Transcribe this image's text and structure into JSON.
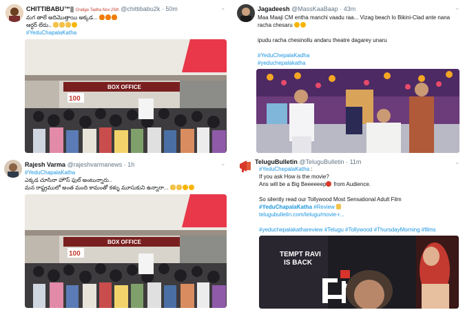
{
  "tweets": [
    {
      "name": "CHITTIBABU™||",
      "badge": "Oraliga Tadha Nov 25th",
      "handle": "@chittibabu2k",
      "time": "50m",
      "line1": "మగ తాలే అదిమొత్తాయి అక్కడ...",
      "line2": "ఆర్ధర్ లేదు..",
      "hashtag": "#YeduChapalaKatha",
      "photo_texts": [
        "BOX OFFICE",
        "100"
      ]
    },
    {
      "name": "Jagadeesh",
      "handle": "@MassKaaBaap",
      "time": "43m",
      "line1": "Maa Maaji CM entha manchi vaadu raa... Vizag beach lo Bikini-Clad ante nana",
      "line2": "racha chesaru",
      "line3": "ipudu racha chesinollu andaru theatre dagarey unaru",
      "hashtag1": "#YeduChepalaKadha",
      "hashtag2": "#yeduchepalakatha"
    },
    {
      "name": "Rajesh Varma",
      "handle": "@rajeshvarmanews",
      "time": "1h",
      "hashtag": "#YeduChapalaKatha",
      "line1": "ఎక్కడ చూసినా హౌస్ ఫుల్ అంటున్నారు..",
      "line2": "మన రాష్ట్రములో అంత మంది కామంతో కళ్ళు మూసుకుని ఉన్నారా...",
      "photo_texts": [
        "BOX OFFICE",
        "100"
      ]
    },
    {
      "name": "TeluguBulletin",
      "handle": "@TeluguBulletin",
      "time": "11m",
      "hashtag": "#YeduChepalaKatha",
      "colon": " :",
      "line1": "If you ask How is the movie?",
      "line2a": "Ans will be a Big Beeeeeep",
      "line2b": " from Audience.",
      "line3": "So silently read our Tollywood Most Sensational Adult Film",
      "bold_tag": "#YeduChapalaKatha",
      "review_tag": "#Review",
      "link": "telugubulletin.com/telugu/movie-r...",
      "tags_line": [
        "#yeduchepalakathareview",
        "#Telugu",
        "#Tollywood",
        "#ThursdayMorning",
        "#films"
      ],
      "poster_text1": "TEMPT RAVI",
      "poster_text2": "IS BACK"
    }
  ],
  "icons": {
    "chevron": "chevron-down-icon"
  },
  "colors": {
    "link": "#1b95e0",
    "text": "#14171a",
    "meta": "#657786"
  }
}
